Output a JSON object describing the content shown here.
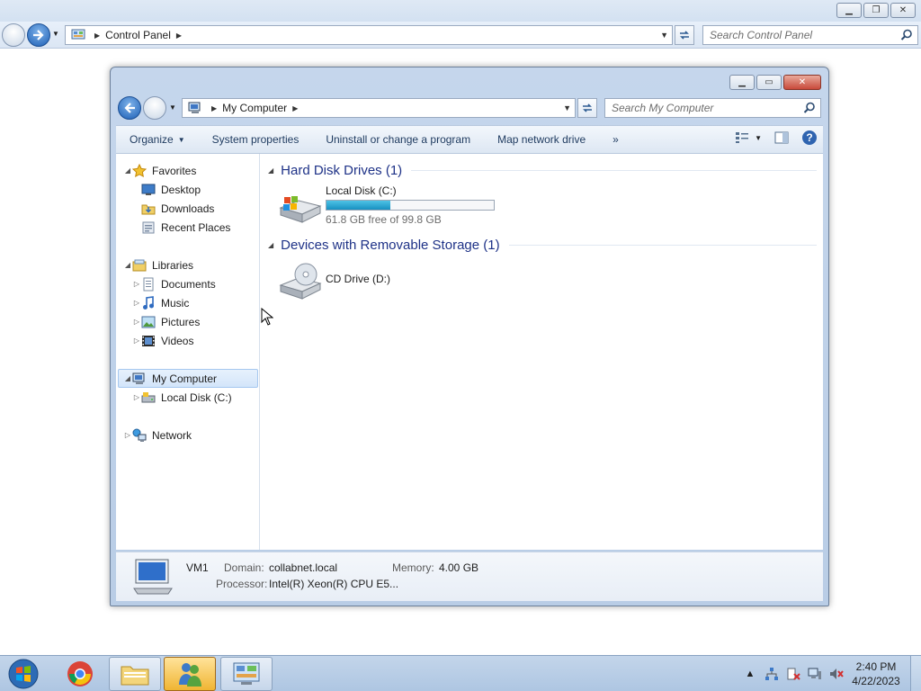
{
  "background_window": {
    "address": {
      "icon": "control-panel-icon",
      "crumbs": [
        "Control Panel"
      ]
    },
    "search": {
      "placeholder": "Search Control Panel"
    }
  },
  "window": {
    "address": {
      "icon": "computer-icon",
      "crumbs": [
        "My Computer"
      ]
    },
    "search": {
      "placeholder": "Search My Computer"
    },
    "toolbar": {
      "items": [
        {
          "label": "Organize",
          "has_dropdown": true
        },
        {
          "label": "System properties"
        },
        {
          "label": "Uninstall or change a program"
        },
        {
          "label": "Map network drive"
        }
      ],
      "more_label": "»"
    },
    "nav_pane": {
      "favorites": {
        "label": "Favorites",
        "items": [
          "Desktop",
          "Downloads",
          "Recent Places"
        ]
      },
      "libraries": {
        "label": "Libraries",
        "items": [
          "Documents",
          "Music",
          "Pictures",
          "Videos"
        ]
      },
      "computer": {
        "label": "My Computer",
        "selected": true,
        "items": [
          "Local Disk (C:)"
        ]
      },
      "network": {
        "label": "Network"
      }
    },
    "groups": [
      {
        "header": "Hard Disk Drives (1)",
        "drives": [
          {
            "name": "Local Disk (C:)",
            "free_text": "61.8 GB free of 99.8 GB",
            "used_fraction": 0.38
          }
        ]
      },
      {
        "header": "Devices with Removable Storage (1)",
        "drives": [
          {
            "name": "CD Drive (D:)"
          }
        ]
      }
    ],
    "details": {
      "computer_name": "VM1",
      "domain_label": "Domain:",
      "domain_value": "collabnet.local",
      "memory_label": "Memory:",
      "memory_value": "4.00 GB",
      "processor_label": "Processor:",
      "processor_value": "Intel(R) Xeon(R) CPU E5..."
    }
  },
  "taskbar": {
    "clock": {
      "time": "2:40 PM",
      "date": "4/22/2023"
    },
    "pinned": [
      "chrome-icon",
      "explorer-icon",
      "users-icon",
      "control-panel-icon"
    ]
  },
  "colors": {
    "accent": "#1e3287",
    "selection": "#d3e5fa",
    "capacity_fill": "#1790c1"
  }
}
